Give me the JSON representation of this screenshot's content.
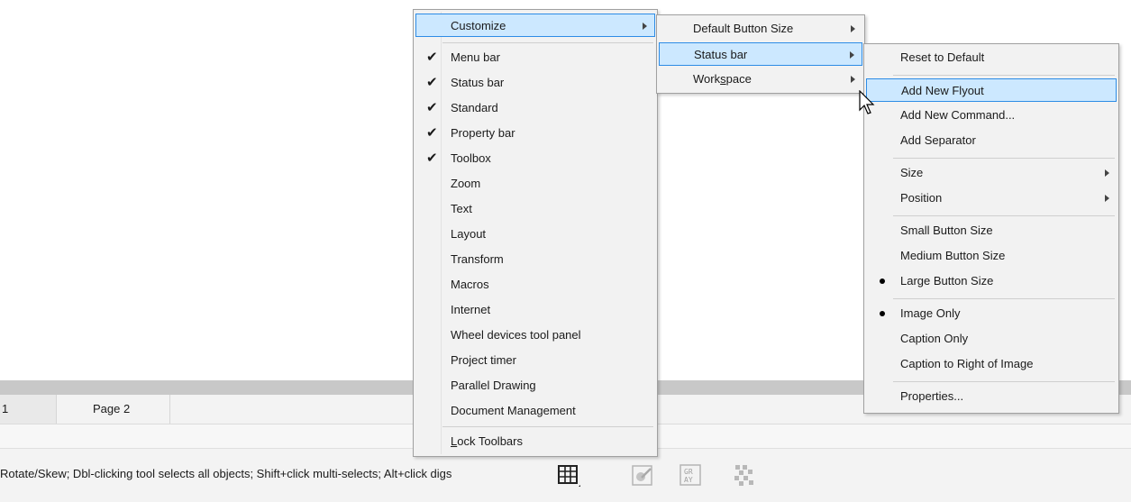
{
  "tabs": {
    "page1": "1",
    "page2": "Page 2"
  },
  "status_bar": {
    "hint": "Rotate/Skew; Dbl-clicking tool selects all objects; Shift+click multi-selects; Alt+click digs"
  },
  "status_icons": [
    "grid-table-icon",
    "color-proof-icon",
    "grayscale-icon",
    "pattern-icon"
  ],
  "menu_main": {
    "customize": "Customize",
    "items": [
      {
        "label": "Menu bar",
        "checked": true
      },
      {
        "label": "Status bar",
        "checked": true
      },
      {
        "label": "Standard",
        "checked": true
      },
      {
        "label": "Property bar",
        "checked": true
      },
      {
        "label": "Toolbox",
        "checked": true
      },
      {
        "label": "Zoom",
        "checked": false
      },
      {
        "label": "Text",
        "checked": false
      },
      {
        "label": "Layout",
        "checked": false
      },
      {
        "label": "Transform",
        "checked": false
      },
      {
        "label": "Macros",
        "checked": false
      },
      {
        "label": "Internet",
        "checked": false
      },
      {
        "label": "Wheel devices tool panel",
        "checked": false
      },
      {
        "label": "Project timer",
        "checked": false
      },
      {
        "label": "Parallel Drawing",
        "checked": false
      },
      {
        "label": "Document Management",
        "checked": false
      }
    ],
    "lock_prefix": "L",
    "lock_rest": "ock Toolbars"
  },
  "menu_customize": {
    "default_button_size": "Default Button Size",
    "status_bar": "Status bar",
    "workspace_pre": "Work",
    "workspace_u": "s",
    "workspace_post": "pace"
  },
  "menu_statusbar": {
    "reset": "Reset to Default",
    "add_flyout": "Add New Flyout",
    "add_command": "Add New Command...",
    "add_separator": "Add Separator",
    "size": "Size",
    "position": "Position",
    "small": "Small Button Size",
    "medium": "Medium Button Size",
    "large": "Large Button Size",
    "image_only": "Image Only",
    "caption_only": "Caption Only",
    "caption_right": "Caption to Right of Image",
    "properties": "Properties..."
  },
  "colors": {
    "highlight": "#cce8ff",
    "highlight_border": "#2d8ce6",
    "menu_bg": "#f2f2f2"
  }
}
